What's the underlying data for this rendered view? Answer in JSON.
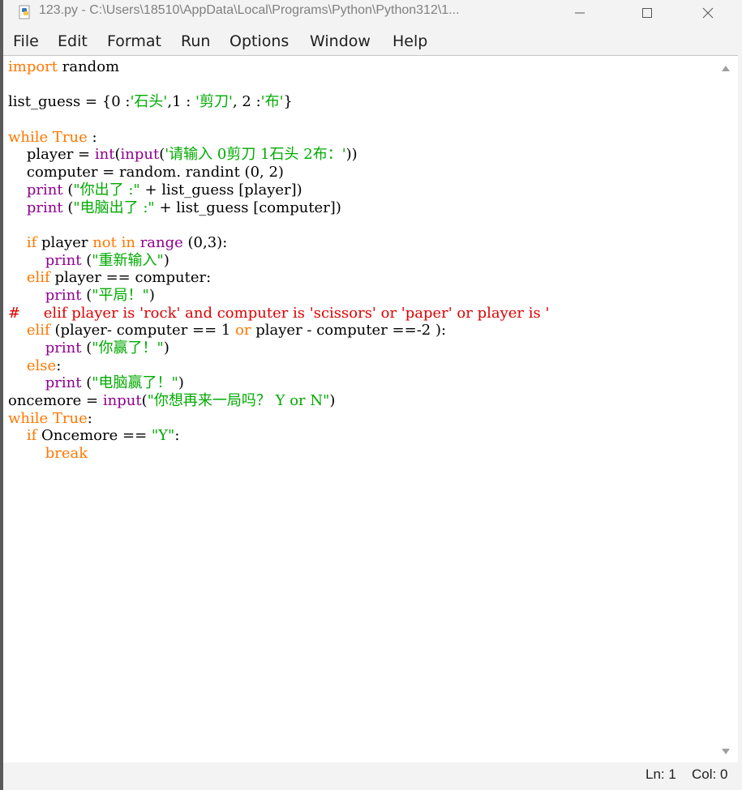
{
  "window": {
    "title": "123.py - C:\\Users\\18510\\AppData\\Local\\Programs\\Python\\Python312\\1...",
    "app_icon": "python-file-icon",
    "controls": [
      "minimize-icon",
      "maximize-icon",
      "close-icon"
    ]
  },
  "menu": {
    "file": "File",
    "edit": "Edit",
    "format": "Format",
    "run": "Run",
    "options": "Options",
    "window": "Window",
    "help": "Help"
  },
  "editor": {
    "lines": [
      [
        {
          "t": "import",
          "c": "kw"
        },
        {
          "t": " random"
        }
      ],
      [],
      [
        {
          "t": "list_guess = {0 :"
        },
        {
          "t": "'石头'",
          "c": "st"
        },
        {
          "t": ",1 : "
        },
        {
          "t": "'剪刀'",
          "c": "st"
        },
        {
          "t": ", 2 :"
        },
        {
          "t": "'布'",
          "c": "st"
        },
        {
          "t": "}"
        }
      ],
      [],
      [
        {
          "t": "while",
          "c": "kw"
        },
        {
          "t": " "
        },
        {
          "t": "True",
          "c": "kw"
        },
        {
          "t": " :"
        }
      ],
      [
        {
          "t": "    player = "
        },
        {
          "t": "int",
          "c": "bi"
        },
        {
          "t": "("
        },
        {
          "t": "input",
          "c": "bi"
        },
        {
          "t": "("
        },
        {
          "t": "'请输入 0剪刀 1石头 2布：'",
          "c": "st"
        },
        {
          "t": "))"
        }
      ],
      [
        {
          "t": "    computer = random. randint (0, 2)"
        }
      ],
      [
        {
          "t": "    "
        },
        {
          "t": "print",
          "c": "bi"
        },
        {
          "t": " ("
        },
        {
          "t": "\"你出了 :\"",
          "c": "st"
        },
        {
          "t": " + list_guess [player])"
        }
      ],
      [
        {
          "t": "    "
        },
        {
          "t": "print",
          "c": "bi"
        },
        {
          "t": " ("
        },
        {
          "t": "\"电脑出了 :\"",
          "c": "st"
        },
        {
          "t": " + list_guess [computer])"
        }
      ],
      [],
      [
        {
          "t": "    "
        },
        {
          "t": "if",
          "c": "kw"
        },
        {
          "t": " player "
        },
        {
          "t": "not",
          "c": "kw"
        },
        {
          "t": " "
        },
        {
          "t": "in",
          "c": "kw"
        },
        {
          "t": " "
        },
        {
          "t": "range",
          "c": "bi"
        },
        {
          "t": " (0,3):"
        }
      ],
      [
        {
          "t": "        "
        },
        {
          "t": "print",
          "c": "bi"
        },
        {
          "t": " ("
        },
        {
          "t": "\"重新输入\"",
          "c": "st"
        },
        {
          "t": ")"
        }
      ],
      [
        {
          "t": "    "
        },
        {
          "t": "elif",
          "c": "kw"
        },
        {
          "t": " player == computer:"
        }
      ],
      [
        {
          "t": "        "
        },
        {
          "t": "print",
          "c": "bi"
        },
        {
          "t": " ("
        },
        {
          "t": "\"平局！\"",
          "c": "st"
        },
        {
          "t": ")"
        }
      ],
      [
        {
          "t": "#     elif player is 'rock' and computer is 'scissors' or 'paper' or player is '",
          "c": "cm"
        }
      ],
      [
        {
          "t": "    "
        },
        {
          "t": "elif",
          "c": "kw"
        },
        {
          "t": " (player- computer == 1 "
        },
        {
          "t": "or",
          "c": "kw"
        },
        {
          "t": " player - computer ==-2 ):"
        }
      ],
      [
        {
          "t": "        "
        },
        {
          "t": "print",
          "c": "bi"
        },
        {
          "t": " ("
        },
        {
          "t": "\"你赢了！\"",
          "c": "st"
        },
        {
          "t": ")"
        }
      ],
      [
        {
          "t": "    "
        },
        {
          "t": "else",
          "c": "kw"
        },
        {
          "t": ":"
        }
      ],
      [
        {
          "t": "        "
        },
        {
          "t": "print",
          "c": "bi"
        },
        {
          "t": " ("
        },
        {
          "t": "\"电脑赢了！\"",
          "c": "st"
        },
        {
          "t": ")"
        }
      ],
      [
        {
          "t": "oncemore = "
        },
        {
          "t": "input",
          "c": "bi"
        },
        {
          "t": "("
        },
        {
          "t": "\"你想再来一局吗？ Y or N\"",
          "c": "st"
        },
        {
          "t": ")"
        }
      ],
      [
        {
          "t": "while",
          "c": "kw"
        },
        {
          "t": " "
        },
        {
          "t": "True",
          "c": "kw"
        },
        {
          "t": ":"
        }
      ],
      [
        {
          "t": "    "
        },
        {
          "t": "if",
          "c": "kw"
        },
        {
          "t": " Oncemore == "
        },
        {
          "t": "\"Y\"",
          "c": "st"
        },
        {
          "t": ":"
        }
      ],
      [
        {
          "t": "        "
        },
        {
          "t": "break",
          "c": "kw"
        }
      ]
    ]
  },
  "status": {
    "ln": "Ln: 1",
    "col": "Col: 0"
  },
  "colors": {
    "keyword": "#ff7700",
    "builtin": "#900090",
    "string": "#00aa00",
    "comment": "#dd0000"
  }
}
